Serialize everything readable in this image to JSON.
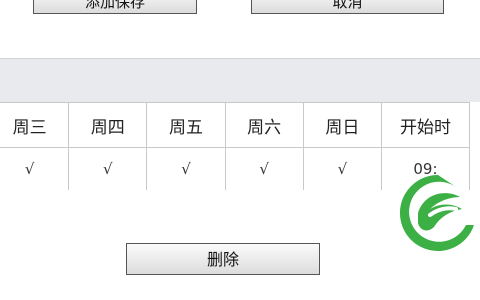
{
  "toolbar": {
    "add_save_label": "添加保存",
    "cancel_label": "取消"
  },
  "schedule": {
    "headers": [
      "周三",
      "周四",
      "周五",
      "周六",
      "周日",
      "开始时"
    ],
    "rows": [
      [
        "√",
        "√",
        "√",
        "√",
        "√",
        "09:"
      ]
    ]
  },
  "actions": {
    "delete_label": "删除"
  },
  "colors": {
    "band": "#e9eaed",
    "border": "#c9c9c9",
    "watermark_green": "#3cb044"
  },
  "watermark": {
    "icon": "green-leaf-logo"
  }
}
